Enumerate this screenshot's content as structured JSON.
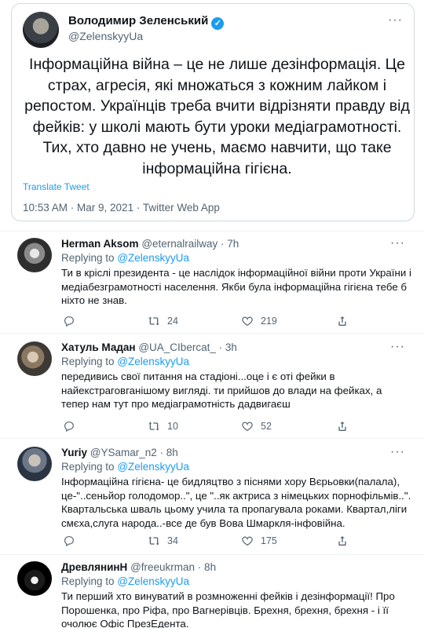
{
  "main_tweet": {
    "name": "Володимир Зеленський",
    "handle": "@ZelenskyyUa",
    "more": "···",
    "text": "Інформаційна війна – це не лише дезінформація. Це страх, агресія, які множаться з кожним лайком і репостом. Українців треба вчити відрізняти правду від фейків: у школі мають бути уроки медіаграмотності. Тих, хто давно не учень, маємо навчити, що таке інформаційна гігієна.",
    "translate": "Translate Tweet",
    "meta": "10:53 AM · Mar 9, 2021 · Twitter Web App"
  },
  "replying_label": "Replying to",
  "replies": [
    {
      "name": "Herman Aksom",
      "handle": "@eternalrailway · 7h",
      "mention": "@ZelenskyyUa",
      "text": "Ти в кріслі президента - це наслідок інформаційної війни проти України і медіабезграмотності населення. Якби була інформаційна гігієна тебе б ніхто не знав.",
      "replies_count": "",
      "retweets": "24",
      "likes": "219"
    },
    {
      "name": "Хатуль Мадан",
      "handle": "@UA_CIbercat_ · 3h",
      "mention": "@ZelenskyyUa",
      "text": "передивись свої питання на стадіоні...оце і є оті фейки в найекстраговганішому вигляді. ти прийшов до влади на фейках, а тепер нам тут про медіаграмотність дадвигаєш",
      "replies_count": "",
      "retweets": "10",
      "likes": "52"
    },
    {
      "name": "Yuriy",
      "handle": "@YSamar_n2 · 8h",
      "mention": "@ZelenskyyUa",
      "text": "Інформаційна гігієна- це бидляцтво з піснями хору Вєрьовки(палала), це-\"..сеньйор голодомор..\", це \"..як актриса з німецьких порнофільмів..\". Квартальська шваль цьому учила та пропагувала роками.  Квартал,ліги смєха,слуга народа..-все де був Вова Шмаркля-інфовійна.",
      "replies_count": "",
      "retweets": "34",
      "likes": "175"
    },
    {
      "name": "ДревлянинН",
      "handle": "@freeukrman · 8h",
      "mention": "@ZelenskyyUa",
      "text": "Ти перший хто винуватий в розмноженні фейків і дезінформації! Про Порошенка, про Ріфа, про Вагнерівців. Брехня, брехня, брехня - і її очолює Офіс ПрезЕдента."
    }
  ],
  "icons": {
    "reply": "reply-icon",
    "retweet": "retweet-icon",
    "like": "heart-icon",
    "share": "share-icon",
    "verified": "verified-badge-icon"
  },
  "colors": {
    "accent": "#1d9bf0",
    "muted": "#536471",
    "text": "#0f1419",
    "border": "#cfd9de"
  }
}
